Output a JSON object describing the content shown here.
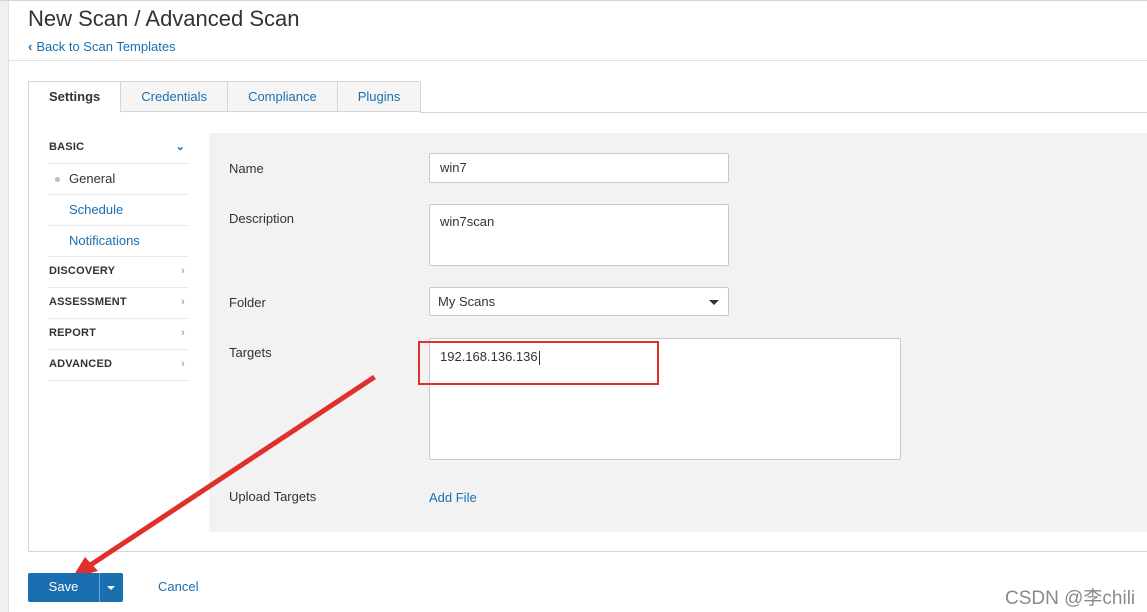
{
  "header": {
    "title": "New Scan / Advanced Scan",
    "back_link": "Back to Scan Templates"
  },
  "tabs": [
    {
      "label": "Settings",
      "active": true
    },
    {
      "label": "Credentials",
      "active": false
    },
    {
      "label": "Compliance",
      "active": false
    },
    {
      "label": "Plugins",
      "active": false
    }
  ],
  "sidebar": {
    "basic": "BASIC",
    "general": "General",
    "schedule": "Schedule",
    "notifications": "Notifications",
    "discovery": "DISCOVERY",
    "assessment": "ASSESSMENT",
    "report": "REPORT",
    "advanced": "ADVANCED"
  },
  "form": {
    "name_label": "Name",
    "name_value": "win7",
    "description_label": "Description",
    "description_value": "win7scan",
    "folder_label": "Folder",
    "folder_value": "My Scans",
    "targets_label": "Targets",
    "targets_value": "192.168.136.136",
    "upload_label": "Upload Targets",
    "add_file": "Add File"
  },
  "actions": {
    "save": "Save",
    "cancel": "Cancel"
  },
  "watermark": "CSDN @李chili",
  "colors": {
    "accent": "#1a6fb0",
    "annotation": "#e0302e"
  }
}
